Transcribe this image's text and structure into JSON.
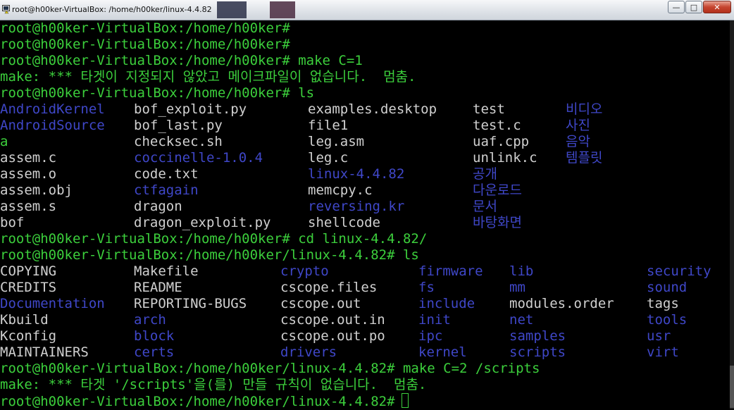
{
  "window": {
    "title": "root@h00ker-VirtualBox: /home/h00ker/linux-4.4.82",
    "buttons": {
      "minimize": "—",
      "maximize": "□",
      "close": "✕"
    }
  },
  "colors": {
    "background": "#000000",
    "prompt": "#3ccf3c",
    "file": "#d0d0d0",
    "directory": "#3f47c8",
    "executable": "#3ccf3c"
  },
  "terminal": {
    "lines": [
      {
        "kind": "text",
        "text": "root@h00ker-VirtualBox:/home/h00ker#"
      },
      {
        "kind": "text",
        "text": "root@h00ker-VirtualBox:/home/h00ker#"
      },
      {
        "kind": "text",
        "text": "root@h00ker-VirtualBox:/home/h00ker# make C=1"
      },
      {
        "kind": "text",
        "text": "make: *** 타겟이 지정되지 않았고 메이크파일이 없습니다.  멈춤."
      },
      {
        "kind": "text",
        "text": "root@h00ker-VirtualBox:/home/h00ker# ls"
      },
      {
        "kind": "ls",
        "cells": [
          {
            "text": "AndroidKernel",
            "type": "dir"
          },
          {
            "text": "bof_exploit.py",
            "type": "file"
          },
          {
            "text": "examples.desktop",
            "type": "file"
          },
          {
            "text": "test",
            "type": "file"
          },
          {
            "text": "비디오",
            "type": "dir"
          }
        ]
      },
      {
        "kind": "ls",
        "cells": [
          {
            "text": "AndroidSource",
            "type": "dir"
          },
          {
            "text": "bof_last.py",
            "type": "file"
          },
          {
            "text": "file1",
            "type": "file"
          },
          {
            "text": "test.c",
            "type": "file"
          },
          {
            "text": "사진",
            "type": "dir"
          }
        ]
      },
      {
        "kind": "ls",
        "cells": [
          {
            "text": "a",
            "type": "exe"
          },
          {
            "text": "checksec.sh",
            "type": "file"
          },
          {
            "text": "leg.asm",
            "type": "file"
          },
          {
            "text": "uaf.cpp",
            "type": "file"
          },
          {
            "text": "음악",
            "type": "dir"
          }
        ]
      },
      {
        "kind": "ls",
        "cells": [
          {
            "text": "assem.c",
            "type": "file"
          },
          {
            "text": "coccinelle-1.0.4",
            "type": "dir"
          },
          {
            "text": "leg.c",
            "type": "file"
          },
          {
            "text": "unlink.c",
            "type": "file"
          },
          {
            "text": "템플릿",
            "type": "dir"
          }
        ]
      },
      {
        "kind": "ls",
        "cells": [
          {
            "text": "assem.o",
            "type": "file"
          },
          {
            "text": "code.txt",
            "type": "file"
          },
          {
            "text": "linux-4.4.82",
            "type": "dir"
          },
          {
            "text": "공개",
            "type": "dir"
          },
          {
            "text": "",
            "type": "file"
          }
        ]
      },
      {
        "kind": "ls",
        "cells": [
          {
            "text": "assem.obj",
            "type": "file"
          },
          {
            "text": "ctfagain",
            "type": "dir"
          },
          {
            "text": "memcpy.c",
            "type": "file"
          },
          {
            "text": "다운로드",
            "type": "dir"
          },
          {
            "text": "",
            "type": "file"
          }
        ]
      },
      {
        "kind": "ls",
        "cells": [
          {
            "text": "assem.s",
            "type": "file"
          },
          {
            "text": "dragon",
            "type": "file"
          },
          {
            "text": "reversing.kr",
            "type": "dir"
          },
          {
            "text": "문서",
            "type": "dir"
          },
          {
            "text": "",
            "type": "file"
          }
        ]
      },
      {
        "kind": "ls",
        "cells": [
          {
            "text": "bof",
            "type": "file"
          },
          {
            "text": "dragon_exploit.py",
            "type": "file"
          },
          {
            "text": "shellcode",
            "type": "file"
          },
          {
            "text": "바탕화면",
            "type": "dir"
          },
          {
            "text": "",
            "type": "file"
          }
        ]
      },
      {
        "kind": "text",
        "text": "root@h00ker-VirtualBox:/home/h00ker# cd linux-4.4.82/"
      },
      {
        "kind": "text",
        "text": "root@h00ker-VirtualBox:/home/h00ker/linux-4.4.82# ls"
      },
      {
        "kind": "ls2",
        "cells": [
          {
            "text": "COPYING",
            "type": "file"
          },
          {
            "text": "Makefile",
            "type": "file"
          },
          {
            "text": "crypto",
            "type": "dir"
          },
          {
            "text": "firmware",
            "type": "dir"
          },
          {
            "text": "lib",
            "type": "dir"
          },
          {
            "text": "security",
            "type": "dir"
          }
        ]
      },
      {
        "kind": "ls2",
        "cells": [
          {
            "text": "CREDITS",
            "type": "file"
          },
          {
            "text": "README",
            "type": "file"
          },
          {
            "text": "cscope.files",
            "type": "file"
          },
          {
            "text": "fs",
            "type": "dir"
          },
          {
            "text": "mm",
            "type": "dir"
          },
          {
            "text": "sound",
            "type": "dir"
          }
        ]
      },
      {
        "kind": "ls2",
        "cells": [
          {
            "text": "Documentation",
            "type": "dir"
          },
          {
            "text": "REPORTING-BUGS",
            "type": "file"
          },
          {
            "text": "cscope.out",
            "type": "file"
          },
          {
            "text": "include",
            "type": "dir"
          },
          {
            "text": "modules.order",
            "type": "file"
          },
          {
            "text": "tags",
            "type": "file"
          }
        ]
      },
      {
        "kind": "ls2",
        "cells": [
          {
            "text": "Kbuild",
            "type": "file"
          },
          {
            "text": "arch",
            "type": "dir"
          },
          {
            "text": "cscope.out.in",
            "type": "file"
          },
          {
            "text": "init",
            "type": "dir"
          },
          {
            "text": "net",
            "type": "dir"
          },
          {
            "text": "tools",
            "type": "dir"
          }
        ]
      },
      {
        "kind": "ls2",
        "cells": [
          {
            "text": "Kconfig",
            "type": "file"
          },
          {
            "text": "block",
            "type": "dir"
          },
          {
            "text": "cscope.out.po",
            "type": "file"
          },
          {
            "text": "ipc",
            "type": "dir"
          },
          {
            "text": "samples",
            "type": "dir"
          },
          {
            "text": "usr",
            "type": "dir"
          }
        ]
      },
      {
        "kind": "ls2",
        "cells": [
          {
            "text": "MAINTAINERS",
            "type": "file"
          },
          {
            "text": "certs",
            "type": "dir"
          },
          {
            "text": "drivers",
            "type": "dir"
          },
          {
            "text": "kernel",
            "type": "dir"
          },
          {
            "text": "scripts",
            "type": "dir"
          },
          {
            "text": "virt",
            "type": "dir"
          }
        ]
      },
      {
        "kind": "text",
        "text": "root@h00ker-VirtualBox:/home/h00ker/linux-4.4.82# make C=2 /scripts"
      },
      {
        "kind": "text",
        "text": "make: *** 타겟 '/scripts'을(를) 만들 규칙이 없습니다.  멈춤."
      },
      {
        "kind": "prompt",
        "text": "root@h00ker-VirtualBox:/home/h00ker/linux-4.4.82#"
      }
    ]
  }
}
